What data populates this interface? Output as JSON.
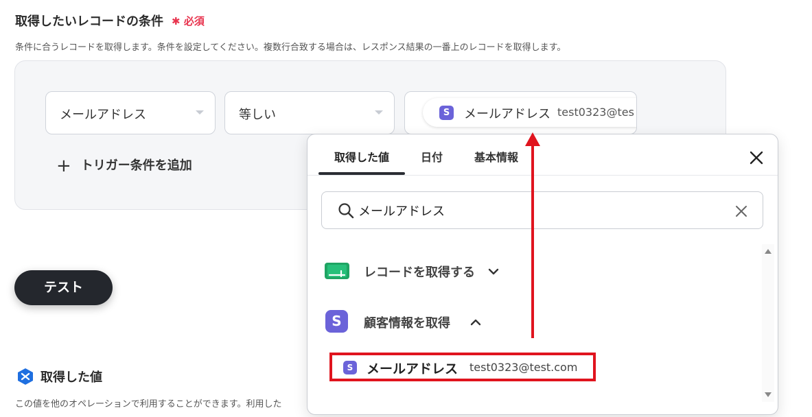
{
  "section": {
    "title": "取得したいレコードの条件",
    "required": "必須",
    "description": "条件に合うレコードを取得します。条件を設定してください。複数行合致する場合は、レスポンス結果の一番上のレコードを取得します。"
  },
  "condition": {
    "field": "メールアドレス",
    "operator": "等しい",
    "value_label": "メールアドレス",
    "value_text": "test0323@tes",
    "add_label": "トリガー条件を追加"
  },
  "test_button": "テスト",
  "acquired": {
    "title": "取得した値",
    "description": "この値を他のオペレーションで利用することができます。利用した"
  },
  "popup": {
    "tabs": [
      {
        "label": "取得した値"
      },
      {
        "label": "日付"
      },
      {
        "label": "基本情報"
      }
    ],
    "search_value": "メールアドレス",
    "groups": [
      {
        "label": "レコードを取得する"
      },
      {
        "label": "顧客情報を取得"
      }
    ],
    "result": {
      "label": "メールアドレス",
      "value": "test0323@test.com"
    }
  },
  "colors": {
    "accent_purple": "#6b63d9",
    "required_red": "#e8344e",
    "highlight_red": "#e0141e",
    "dark_button": "#24272d"
  }
}
